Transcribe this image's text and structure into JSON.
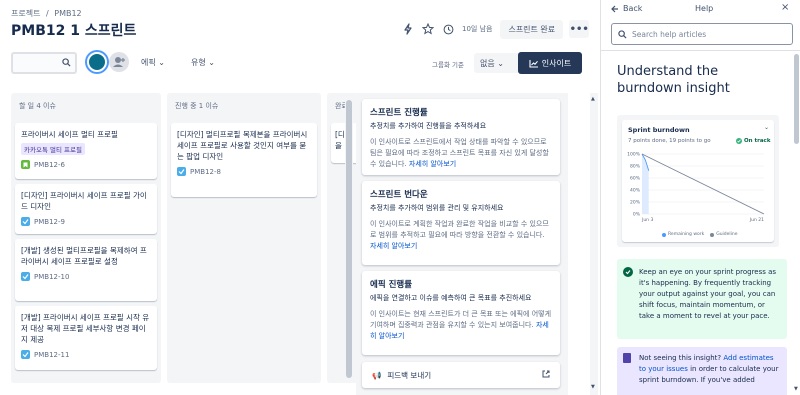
{
  "breadcrumb": [
    "프로젝트",
    "/",
    "PMB12"
  ],
  "page_title": "PMB12 1 스프린트",
  "header": {
    "days_left": "10일 남음",
    "complete_sprint": "스프린트 완료",
    "more": "•••"
  },
  "toolbar": {
    "filter_epic": "에픽",
    "filter_type": "유형",
    "group_by_label": "그룹화 기준",
    "group_by_value": "없음",
    "insights_button": "인사이트"
  },
  "columns": [
    {
      "title": "할 일 4 이슈",
      "cards": [
        {
          "title": "프라이버시 세이프 멀티 프로필",
          "badge": "카카오톡 멀티 프로필",
          "key": "PMB12-6",
          "type": "story"
        },
        {
          "title": "[디자인] 프라이버시 세이프 프로필 가이드 디자인",
          "key": "PMB12-9",
          "type": "task"
        },
        {
          "title": "[개발] 생성된 멀티프로필을 복제하여 프라이버시 세이프 프로필로 설정",
          "key": "PMB12-10",
          "type": "task"
        },
        {
          "title": "[개발] 프라이버시 세이프 프로필 시작 유저 대상 복제 프로필 세부사항 변경 페이지 제공",
          "key": "PMB12-11",
          "type": "task"
        }
      ]
    },
    {
      "title": "진행 중 1 이슈",
      "cards": [
        {
          "title": "[디자인] 멀티프로필 복제본을 프라이버시 세이프 프로필로 사용할 것인지 여부를 묻는 팝업 디자인",
          "key": "PMB12-8",
          "type": "task"
        }
      ]
    },
    {
      "title": "완료",
      "cards": [
        {
          "title": "[디 을"
        }
      ]
    }
  ],
  "insights": [
    {
      "title": "스프린트 진행률",
      "subtitle": "추정치를 추가하여 진행률을 추적하세요",
      "body": "이 인사이트로 스프린트에서 작업 상태를 파악할 수 있으므로 팀은 필요에 따라 조정하고 스프린트 목표를 자신 있게 달성할 수 있습니다.",
      "link": "자세히 알아보기"
    },
    {
      "title": "스프린트 번다운",
      "subtitle": "추정치를 추가하여 범위를 관리 및 유지하세요",
      "body": "이 인사이트로 계획한 작업과 완료한 작업을 비교할 수 있으므로 범위를 추적하고 필요에 따라 방향을 전환할 수 있습니다.",
      "link": "자세히 알아보기"
    },
    {
      "title": "에픽 진행률",
      "subtitle": "에픽을 연결하고 이슈를 예측하여 큰 목표를 추진하세요",
      "body": "이 인사이트는 현재 스프린트가 더 큰 목표 또는 에픽에 어떻게 기여하며 집중력과 관점을 유지할 수 있는지 보여줍니다.",
      "link": "자세히 알아보기"
    }
  ],
  "feedback": "피드백 보내기",
  "help": {
    "back": "Back",
    "title": "Help",
    "search_placeholder": "Search help articles",
    "article_title": "Understand the burndown insight",
    "burndown": {
      "name": "Sprint burndown",
      "progress": "7 points done, 19 points to go",
      "status": "On track",
      "legend_remaining": "Remaining work",
      "legend_guideline": "Guideline"
    },
    "tip": "Keep an eye on your sprint progress as it's happening. By frequently tracking your output against your goal, you can shift focus, maintain momentum, or take a moment to revel at your pace.",
    "note_prefix": "Not seeing this insight? ",
    "note_link": "Add estimates to your issues",
    "note_suffix": " in order to calculate your sprint burndown. If you've added"
  },
  "chart_data": {
    "type": "line",
    "title": "Sprint burndown",
    "x": [
      "Jun 3",
      "Jun 21"
    ],
    "ylabel": "",
    "y_ticks": [
      "0%",
      "20%",
      "40%",
      "60%",
      "80%",
      "100%"
    ],
    "ylim": [
      0,
      100
    ],
    "series": [
      {
        "name": "Remaining work",
        "color": "#4c9aff",
        "x": [
          0,
          0.5,
          1
        ],
        "values": [
          100,
          90,
          72
        ]
      },
      {
        "name": "Guideline",
        "color": "#7a869a",
        "x": [
          0,
          18
        ],
        "values": [
          100,
          0
        ]
      }
    ]
  },
  "colors": {
    "accent": "#0052cc",
    "insights_button_bg": "#253858",
    "tip_bg": "#e3fcef",
    "note_bg": "#eae6ff"
  }
}
